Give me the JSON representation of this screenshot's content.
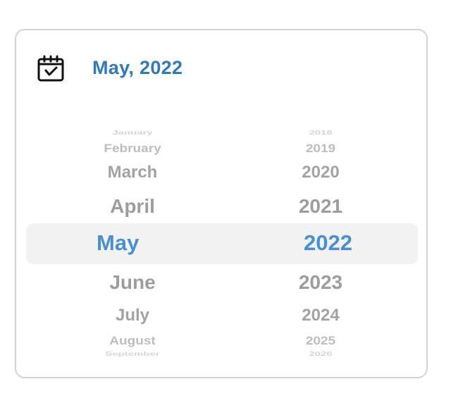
{
  "header": {
    "title": "May, 2022",
    "icon": "calendar-check-icon",
    "accent_color": "#2f7ab8"
  },
  "picker": {
    "selected_color": "#4a8fcf",
    "months": [
      "January",
      "February",
      "March",
      "April",
      "May",
      "June",
      "July",
      "August",
      "September"
    ],
    "years": [
      "2018",
      "2019",
      "2020",
      "2021",
      "2022",
      "2023",
      "2024",
      "2025",
      "2026"
    ],
    "selected_month": "May",
    "selected_year": "2022"
  }
}
